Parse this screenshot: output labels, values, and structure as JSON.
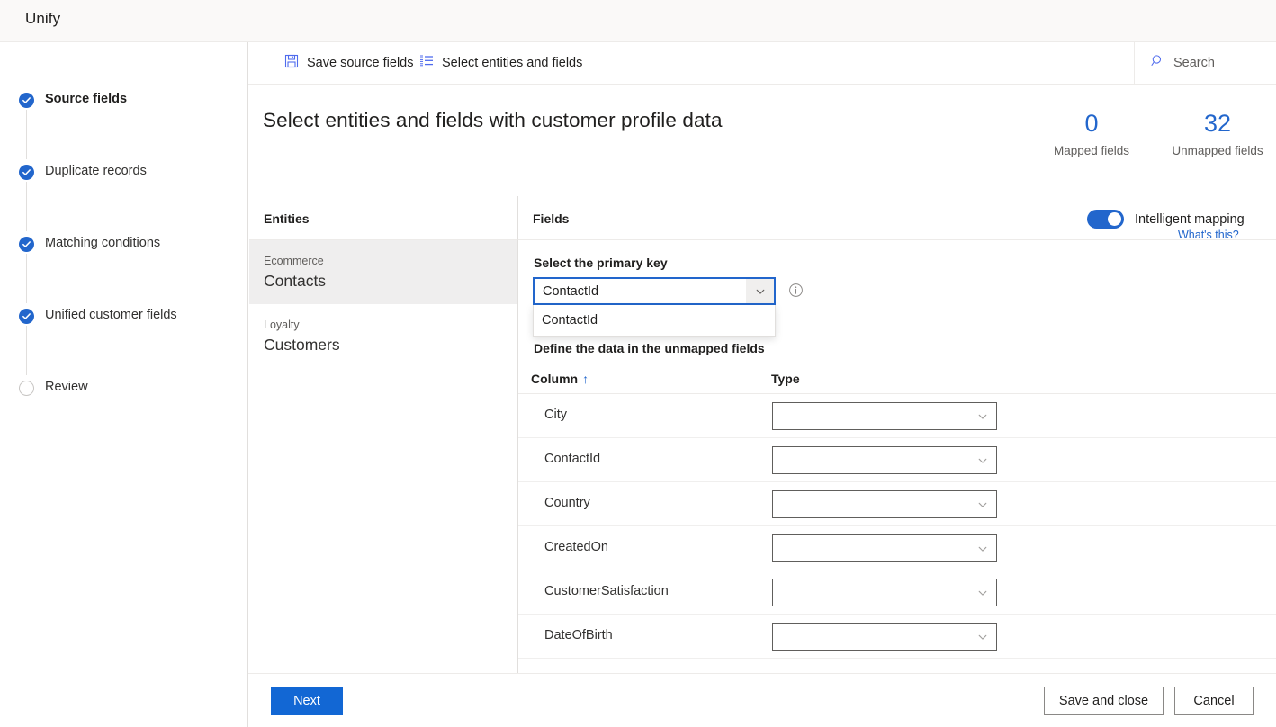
{
  "app": {
    "title": "Unify"
  },
  "wizard": {
    "steps": [
      {
        "label": "Source fields",
        "state": "done",
        "active": true
      },
      {
        "label": "Duplicate records",
        "state": "done",
        "active": false
      },
      {
        "label": "Matching conditions",
        "state": "done",
        "active": false
      },
      {
        "label": "Unified customer fields",
        "state": "done",
        "active": false
      },
      {
        "label": "Review",
        "state": "todo",
        "active": false
      }
    ]
  },
  "commandbar": {
    "save_label": "Save source fields",
    "save_icon": "save-floppy-icon",
    "select_label": "Select entities and fields",
    "select_icon": "numbered-list-icon",
    "search_icon": "search-icon",
    "search_placeholder": "Search"
  },
  "page": {
    "title": "Select entities and fields with customer profile data",
    "stats": [
      {
        "value": "0",
        "caption": "Mapped fields"
      },
      {
        "value": "32",
        "caption": "Unmapped fields"
      }
    ]
  },
  "entities_panel": {
    "header": "Entities",
    "items": [
      {
        "source": "Ecommerce",
        "name": "Contacts",
        "selected": true
      },
      {
        "source": "Loyalty",
        "name": "Customers",
        "selected": false
      }
    ]
  },
  "fields_panel": {
    "header": "Fields",
    "intelligent_mapping": {
      "label": "Intelligent mapping",
      "enabled": true,
      "help_link": "What's this?"
    },
    "primary_key": {
      "label": "Select the primary key",
      "value": "ContactId",
      "open": true,
      "options": [
        "ContactId"
      ],
      "info_icon": "info-circle-icon",
      "chevron_icon": "chevron-down-icon"
    },
    "define_label": "Define the data in the unmapped fields",
    "table": {
      "columns": [
        "Column",
        "Type"
      ],
      "sort_indicator": "↑",
      "rows": [
        {
          "column": "City",
          "type": ""
        },
        {
          "column": "ContactId",
          "type": ""
        },
        {
          "column": "Country",
          "type": ""
        },
        {
          "column": "CreatedOn",
          "type": ""
        },
        {
          "column": "CustomerSatisfaction",
          "type": ""
        },
        {
          "column": "DateOfBirth",
          "type": ""
        }
      ]
    }
  },
  "footer": {
    "next": "Next",
    "save_and_close": "Save and close",
    "cancel": "Cancel"
  },
  "colors": {
    "accent": "#2266cc",
    "primary_button": "#1267d4",
    "selected_row": "#efeeee"
  }
}
